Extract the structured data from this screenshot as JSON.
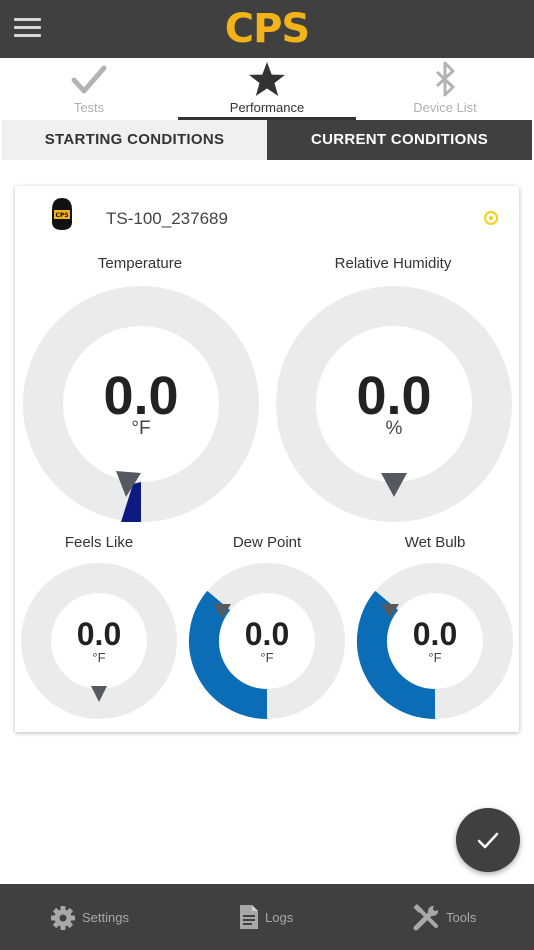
{
  "header": {
    "logo_text": "CPS",
    "menu_icon": "hamburger-menu-icon",
    "logo_color": "#f2b21a"
  },
  "tabs": [
    {
      "label": "Tests",
      "icon": "check-icon",
      "active": false
    },
    {
      "label": "Performance",
      "icon": "star-icon",
      "active": true
    },
    {
      "label": "Device List",
      "icon": "bluetooth-icon",
      "active": false
    }
  ],
  "segments": {
    "starting": "STARTING CONDITIONS",
    "current": "CURRENT CONDITIONS",
    "selected": "current"
  },
  "device": {
    "name": "TS-100_237689",
    "icon": "thermal-sensor-device-icon",
    "status_color": "#f2d21a"
  },
  "gauges": {
    "temperature": {
      "label": "Temperature",
      "value": "0.0",
      "unit": "°F",
      "fill_color": "#0d1a80"
    },
    "humidity": {
      "label": "Relative Humidity",
      "value": "0.0",
      "unit": "%"
    },
    "feels_like": {
      "label": "Feels Like",
      "value": "0.0",
      "unit": "°F"
    },
    "dew_point": {
      "label": "Dew Point",
      "value": "0.0",
      "unit": "°F",
      "fill_color": "#0a6db5"
    },
    "wet_bulb": {
      "label": "Wet Bulb",
      "value": "0.0",
      "unit": "°F",
      "fill_color": "#0a6db5"
    }
  },
  "fab": {
    "icon": "checkmark-icon"
  },
  "bottom_nav": [
    {
      "label": "Settings",
      "icon": "gear-icon"
    },
    {
      "label": "Logs",
      "icon": "document-icon"
    },
    {
      "label": "Tools",
      "icon": "tools-icon"
    }
  ],
  "colors": {
    "bar": "#404040",
    "ring": "#ebebeb",
    "pointer": "#555a60"
  }
}
